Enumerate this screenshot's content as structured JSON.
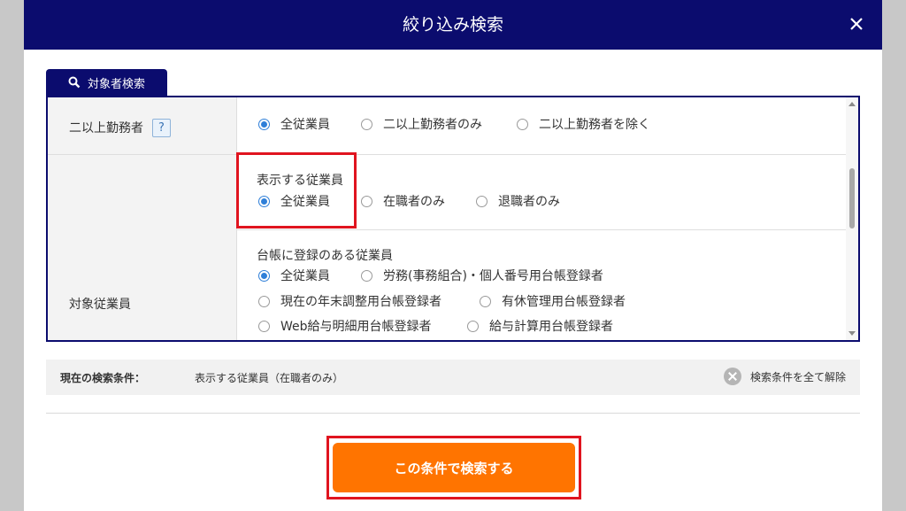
{
  "dialog": {
    "title": "絞り込み検索",
    "close_icon": "close-icon"
  },
  "tab": {
    "label": "対象者検索",
    "icon": "search-icon"
  },
  "rows": {
    "concurrent": {
      "label": "二以上勤務者",
      "help": "?",
      "options": [
        "全従業員",
        "二以上勤務者のみ",
        "二以上勤務者を除く"
      ],
      "selected": "全従業員"
    },
    "target": {
      "label": "対象従業員",
      "display": {
        "title": "表示する従業員",
        "options": [
          "全従業員",
          "在職者のみ",
          "退職者のみ"
        ],
        "selected": "全従業員"
      },
      "registered": {
        "title": "台帳に登録のある従業員",
        "options": [
          "全従業員",
          "労務(事務組合)・個人番号用台帳登録者",
          "現在の年末調整用台帳登録者",
          "有休管理用台帳登録者",
          "Web給与明細用台帳登録者",
          "給与計算用台帳登録者"
        ],
        "selected": "全従業員"
      }
    }
  },
  "criteria": {
    "label": "現在の検索条件：",
    "value": "表示する従業員（在職者のみ）",
    "clear_label": "検索条件を全て解除"
  },
  "submit": {
    "label": "この条件で検索する"
  },
  "colors": {
    "header_bg": "#0b0c6e",
    "accent_orange": "#ff7400",
    "radio_blue": "#2f7fd8",
    "highlight_red": "#e0141f"
  }
}
